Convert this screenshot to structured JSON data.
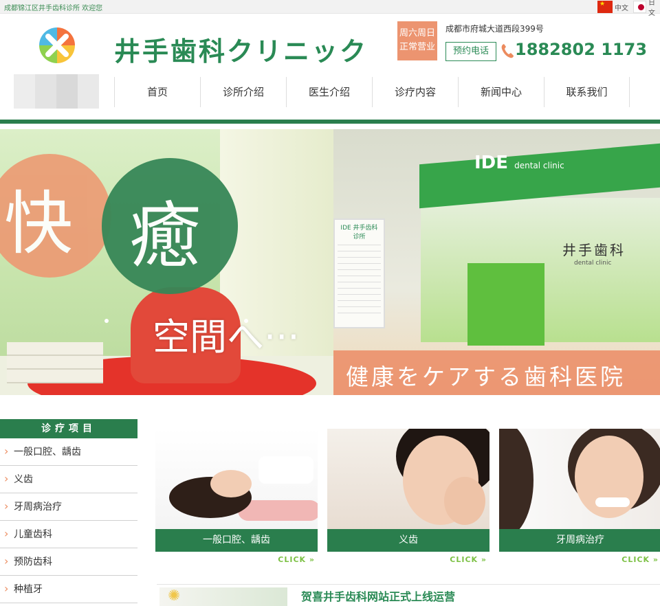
{
  "topbar": {
    "welcome": "成都锦江区井手齿科诊所 欢迎您",
    "lang_cn": "中文",
    "lang_jp": "日文"
  },
  "header": {
    "brand": "井手歯科クリニック",
    "weekend_line1": "周六周日",
    "weekend_line2": "正常营业",
    "address": "成都市府城大道西段399号",
    "book_label": "预约电话",
    "phone": "1882802 1173",
    "logo_colors": [
      "#f4733e",
      "#f8c43a",
      "#4fb9e5",
      "#8fd14f"
    ]
  },
  "nav": {
    "items": [
      "首页",
      "诊所介绍",
      "医生介绍",
      "诊疗内容",
      "新闻中心",
      "联系我们"
    ]
  },
  "banner": {
    "char_kuai": "快",
    "char_yu": "癒",
    "space_text": "空間へ···",
    "tagline": "健康をケアする歯科医院",
    "sign": "IDE",
    "sign_sub": "dental clinic",
    "jp_brand": "井手歯科",
    "jp_brand_sub": "dental clinic",
    "poster_title": "IDE 井手齿科诊所"
  },
  "sidebar": {
    "title": "诊疗项目",
    "items": [
      "一般口腔、龋齿",
      "义齿",
      "牙周病治疗",
      "儿童齿科",
      "预防齿科",
      "种植牙"
    ]
  },
  "cards": [
    {
      "label": "一般口腔、龋齿",
      "click": "CLICK »"
    },
    {
      "label": "义齿",
      "click": "CLICK »"
    },
    {
      "label": "牙周病治疗",
      "click": "CLICK »"
    }
  ],
  "news": {
    "title": "贺喜井手齿科网站正式上线运营"
  },
  "colors": {
    "brand_green": "#2a7e4d",
    "accent_orange": "#ec9470",
    "click_green": "#7bc043"
  }
}
